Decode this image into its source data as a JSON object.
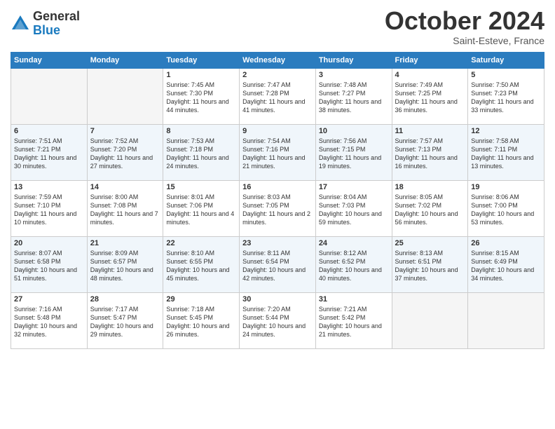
{
  "logo": {
    "general": "General",
    "blue": "Blue"
  },
  "header": {
    "month": "October 2024",
    "location": "Saint-Esteve, France"
  },
  "days_of_week": [
    "Sunday",
    "Monday",
    "Tuesday",
    "Wednesday",
    "Thursday",
    "Friday",
    "Saturday"
  ],
  "weeks": [
    [
      {
        "day": "",
        "info": ""
      },
      {
        "day": "",
        "info": ""
      },
      {
        "day": "1",
        "info": "Sunrise: 7:45 AM\nSunset: 7:30 PM\nDaylight: 11 hours and 44 minutes."
      },
      {
        "day": "2",
        "info": "Sunrise: 7:47 AM\nSunset: 7:28 PM\nDaylight: 11 hours and 41 minutes."
      },
      {
        "day": "3",
        "info": "Sunrise: 7:48 AM\nSunset: 7:27 PM\nDaylight: 11 hours and 38 minutes."
      },
      {
        "day": "4",
        "info": "Sunrise: 7:49 AM\nSunset: 7:25 PM\nDaylight: 11 hours and 36 minutes."
      },
      {
        "day": "5",
        "info": "Sunrise: 7:50 AM\nSunset: 7:23 PM\nDaylight: 11 hours and 33 minutes."
      }
    ],
    [
      {
        "day": "6",
        "info": "Sunrise: 7:51 AM\nSunset: 7:21 PM\nDaylight: 11 hours and 30 minutes."
      },
      {
        "day": "7",
        "info": "Sunrise: 7:52 AM\nSunset: 7:20 PM\nDaylight: 11 hours and 27 minutes."
      },
      {
        "day": "8",
        "info": "Sunrise: 7:53 AM\nSunset: 7:18 PM\nDaylight: 11 hours and 24 minutes."
      },
      {
        "day": "9",
        "info": "Sunrise: 7:54 AM\nSunset: 7:16 PM\nDaylight: 11 hours and 21 minutes."
      },
      {
        "day": "10",
        "info": "Sunrise: 7:56 AM\nSunset: 7:15 PM\nDaylight: 11 hours and 19 minutes."
      },
      {
        "day": "11",
        "info": "Sunrise: 7:57 AM\nSunset: 7:13 PM\nDaylight: 11 hours and 16 minutes."
      },
      {
        "day": "12",
        "info": "Sunrise: 7:58 AM\nSunset: 7:11 PM\nDaylight: 11 hours and 13 minutes."
      }
    ],
    [
      {
        "day": "13",
        "info": "Sunrise: 7:59 AM\nSunset: 7:10 PM\nDaylight: 11 hours and 10 minutes."
      },
      {
        "day": "14",
        "info": "Sunrise: 8:00 AM\nSunset: 7:08 PM\nDaylight: 11 hours and 7 minutes."
      },
      {
        "day": "15",
        "info": "Sunrise: 8:01 AM\nSunset: 7:06 PM\nDaylight: 11 hours and 4 minutes."
      },
      {
        "day": "16",
        "info": "Sunrise: 8:03 AM\nSunset: 7:05 PM\nDaylight: 11 hours and 2 minutes."
      },
      {
        "day": "17",
        "info": "Sunrise: 8:04 AM\nSunset: 7:03 PM\nDaylight: 10 hours and 59 minutes."
      },
      {
        "day": "18",
        "info": "Sunrise: 8:05 AM\nSunset: 7:02 PM\nDaylight: 10 hours and 56 minutes."
      },
      {
        "day": "19",
        "info": "Sunrise: 8:06 AM\nSunset: 7:00 PM\nDaylight: 10 hours and 53 minutes."
      }
    ],
    [
      {
        "day": "20",
        "info": "Sunrise: 8:07 AM\nSunset: 6:58 PM\nDaylight: 10 hours and 51 minutes."
      },
      {
        "day": "21",
        "info": "Sunrise: 8:09 AM\nSunset: 6:57 PM\nDaylight: 10 hours and 48 minutes."
      },
      {
        "day": "22",
        "info": "Sunrise: 8:10 AM\nSunset: 6:55 PM\nDaylight: 10 hours and 45 minutes."
      },
      {
        "day": "23",
        "info": "Sunrise: 8:11 AM\nSunset: 6:54 PM\nDaylight: 10 hours and 42 minutes."
      },
      {
        "day": "24",
        "info": "Sunrise: 8:12 AM\nSunset: 6:52 PM\nDaylight: 10 hours and 40 minutes."
      },
      {
        "day": "25",
        "info": "Sunrise: 8:13 AM\nSunset: 6:51 PM\nDaylight: 10 hours and 37 minutes."
      },
      {
        "day": "26",
        "info": "Sunrise: 8:15 AM\nSunset: 6:49 PM\nDaylight: 10 hours and 34 minutes."
      }
    ],
    [
      {
        "day": "27",
        "info": "Sunrise: 7:16 AM\nSunset: 5:48 PM\nDaylight: 10 hours and 32 minutes."
      },
      {
        "day": "28",
        "info": "Sunrise: 7:17 AM\nSunset: 5:47 PM\nDaylight: 10 hours and 29 minutes."
      },
      {
        "day": "29",
        "info": "Sunrise: 7:18 AM\nSunset: 5:45 PM\nDaylight: 10 hours and 26 minutes."
      },
      {
        "day": "30",
        "info": "Sunrise: 7:20 AM\nSunset: 5:44 PM\nDaylight: 10 hours and 24 minutes."
      },
      {
        "day": "31",
        "info": "Sunrise: 7:21 AM\nSunset: 5:42 PM\nDaylight: 10 hours and 21 minutes."
      },
      {
        "day": "",
        "info": ""
      },
      {
        "day": "",
        "info": ""
      }
    ]
  ]
}
